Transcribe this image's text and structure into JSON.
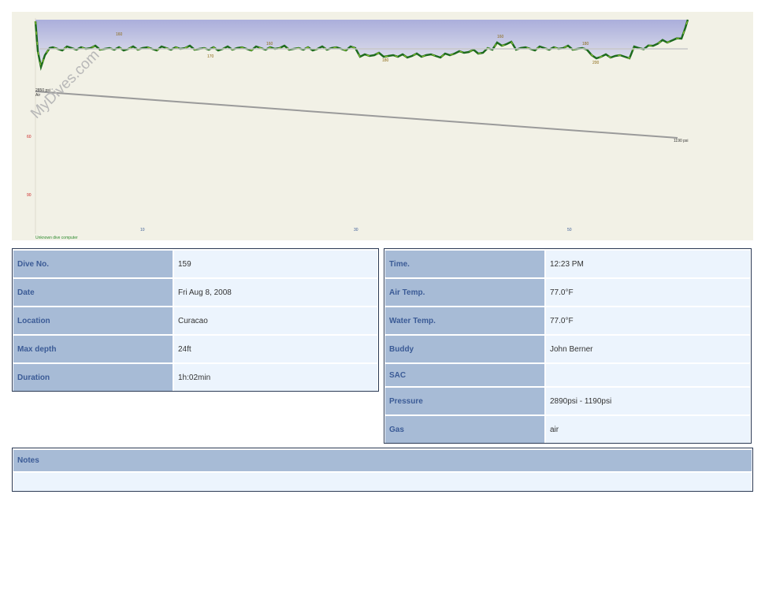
{
  "watermark": "MyDives.com",
  "chart_data": {
    "type": "line",
    "axis": {
      "y_ticks": [
        "60",
        "90"
      ],
      "x_ticks": [
        "10",
        "30",
        "50"
      ]
    },
    "depth_markers": [
      "160",
      "170",
      "160",
      "180",
      "160",
      "200",
      "180"
    ],
    "pressure": {
      "start_label": "2850 psi",
      "start_gas": "Air",
      "end_label": "1190 psi"
    },
    "dive_computer": "Unknown dive computer",
    "colors": {
      "depth_line": "#1e6b1e",
      "pressure_line": "#9a9a9a",
      "fill": "#c4c7e6"
    }
  },
  "left_table": [
    {
      "label": "Dive No.",
      "value": "159"
    },
    {
      "label": "Date",
      "value": "Fri Aug 8, 2008"
    },
    {
      "label": "Location",
      "value": "Curacao"
    },
    {
      "label": "Max depth",
      "value": "24ft"
    },
    {
      "label": "Duration",
      "value": "1h:02min"
    }
  ],
  "right_table": [
    {
      "label": "Time.",
      "value": "12:23 PM"
    },
    {
      "label": "Air Temp.",
      "value": "77.0°F"
    },
    {
      "label": "Water Temp.",
      "value": "77.0°F"
    },
    {
      "label": "Buddy",
      "value": "John Berner"
    },
    {
      "label": "SAC",
      "value": ""
    },
    {
      "label": "Pressure",
      "value": "2890psi - 1190psi"
    },
    {
      "label": "Gas",
      "value": "air"
    }
  ],
  "notes": {
    "label": "Notes",
    "value": ""
  }
}
